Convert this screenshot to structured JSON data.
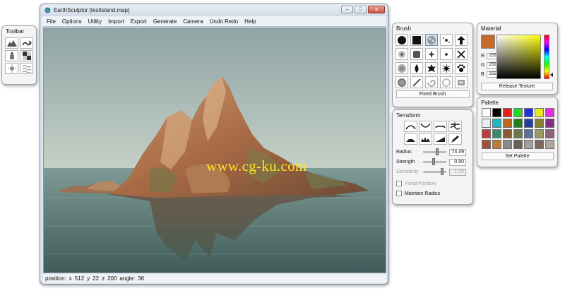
{
  "toolbar": {
    "title": "Toolbar",
    "buttons": [
      {
        "icon": "terrain-icon"
      },
      {
        "icon": "wave-arrow-icon"
      },
      {
        "icon": "object-figure-icon"
      },
      {
        "icon": "checker-texture-icon"
      },
      {
        "icon": "sun-light-icon"
      },
      {
        "icon": "water-icon"
      }
    ]
  },
  "window": {
    "title": "EarthSculptor [testIsland.map]",
    "controls": {
      "minimize": "–",
      "maximize": "□",
      "close": "✕"
    }
  },
  "menubar": {
    "items": [
      "File",
      "Options",
      "Utility",
      "Import",
      "Export",
      "Generate",
      "Camera",
      "Undo Redo",
      "Help"
    ]
  },
  "viewport": {
    "watermark": "www.cg-ku.com"
  },
  "status": {
    "position_label": "position:",
    "x_label": "x",
    "x": "512",
    "y_label": "y",
    "y": "22",
    "z_label": "z",
    "z": "200",
    "angle_label": "angle:",
    "angle": "36"
  },
  "brush": {
    "title": "Brush",
    "fixed_button": "Fixed Brush",
    "selected_index": 2,
    "icons": [
      "circle-brush-icon",
      "square-brush-icon",
      "noise-brush-icon",
      "spray-brush-icon",
      "arrow-up-brush-icon",
      "soft-dot-brush-icon",
      "soft-square-brush-icon",
      "star-small-brush-icon",
      "dot-brush-icon",
      "cross-brush-icon",
      "blur-circle-brush-icon",
      "drop-brush-icon",
      "splat-brush-icon",
      "burst-brush-icon",
      "paw-brush-icon",
      "grain-brush-icon",
      "line-brush-icon",
      "swirl-brush-icon",
      "ring-brush-icon",
      "texture-brush-icon"
    ]
  },
  "terraform": {
    "title": "Terraform",
    "tools_row1": [
      "raise-icon",
      "lower-icon",
      "flatten-icon",
      "smooth-icon"
    ],
    "tools_row2": [
      "hill-icon",
      "erode-icon",
      "ramp-icon",
      "pencil-icon"
    ],
    "sliders": [
      {
        "label": "Radius",
        "value": "74.49",
        "level": 0.62,
        "enabled": true
      },
      {
        "label": "Strength",
        "value": "0.50",
        "level": 0.45,
        "enabled": true
      },
      {
        "label": "Sensitivity",
        "value": "1.00",
        "level": 0.85,
        "enabled": false
      }
    ],
    "checkboxes": [
      {
        "label": "Fixed Position",
        "checked": false,
        "enabled": false
      },
      {
        "label": "Maintain Radius",
        "checked": false,
        "enabled": true
      }
    ]
  },
  "material": {
    "title": "Material",
    "swatch_color": "#c46a2a",
    "r_label": "R",
    "r": "255",
    "g_label": "G",
    "g": "255",
    "b_label": "B",
    "b": "255",
    "release_button": "Release Texture"
  },
  "palette": {
    "title": "Palette",
    "colors": [
      "#ffffff",
      "#000000",
      "#e32020",
      "#2dd12d",
      "#2030e0",
      "#e8e820",
      "#e030e0",
      "#e8eef0",
      "#20b8c0",
      "#c06a20",
      "#208020",
      "#2040a0",
      "#888030",
      "#803080",
      "#b84040",
      "#3c8a6a",
      "#8a5a30",
      "#6a7a4a",
      "#5a70a0",
      "#9a9a60",
      "#90607a",
      "#a0503a",
      "#c07a3a",
      "#8a8a8a",
      "#6a6050",
      "#a0a0a0",
      "#7a6a60",
      "#b0a89a"
    ],
    "set_button": "Set Palette"
  }
}
